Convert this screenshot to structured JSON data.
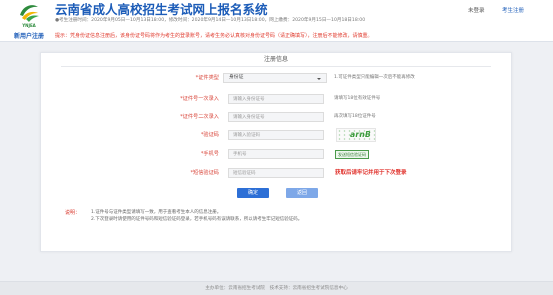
{
  "colors": {
    "title_blue": "#1c5cb8",
    "label_red": "#d9453a",
    "primary_button": "#2d6fd6",
    "secondary_button": "#7ea8e8",
    "sms_green": "#4a9a4a"
  },
  "icons": {
    "logo": "ynjea-emblem-icon",
    "select_arrow": "caret-down-icon"
  },
  "header": {
    "logo_text": "YNJEA",
    "title": "云南省成人高校招生考试网上报名系统",
    "schedule": "●考生注册时间：2020年9月05日—10月13日18:00，修改时间：2020年9月14日—10月13日18:00，网上缴费：2020年9月15日—10月18日18:00",
    "login_status": "未登录",
    "register_link": "考生注册"
  },
  "notice_bar": {
    "section_title": "新用户注册",
    "notice": "提示：凭身份证信息注册后，该身份证号码将作为考生的登录账号，请考生务必认真核对身份证号码（请正确填写），注册后不能修改，请慎重。"
  },
  "form": {
    "title": "注册信息",
    "id_type": {
      "label": "*证件类型",
      "value": "身份证",
      "hint": "1.可证件类型只能编辑一次后不能再修改"
    },
    "id_number_first": {
      "label": "*证件号一次录入",
      "placeholder": "请输入身份证号",
      "hint": "请填写18位有效证件号"
    },
    "id_number_second": {
      "label": "*证件号二次录入",
      "placeholder": "请输入身份证号",
      "hint": "再次填写18位证件号"
    },
    "captcha": {
      "label": "*验证码",
      "placeholder": "请输入验证码",
      "image_text": "arnB"
    },
    "phone": {
      "label": "*手机号",
      "placeholder": "手机号",
      "send_sms_label": "发送短信验证码"
    },
    "sms_code": {
      "label": "*短信验证码",
      "placeholder": "短信验证码",
      "hint": "获取后请牢记并用于下次登录"
    },
    "confirm_label": "确定",
    "back_label": "返回"
  },
  "notes": {
    "title": "说明：",
    "items": [
      "1.证件号与证件类型请填写一致，用于查看考生本人的信息注册。",
      "2.下次登录时请使用的证件号码和短信验证码登录，若手机号码有误请联系，所以请考生牢记短信验证码。"
    ]
  },
  "footer": {
    "text": "主办单位：云南省招生考试院　技术支持：云南省招生考试院信息中心"
  }
}
